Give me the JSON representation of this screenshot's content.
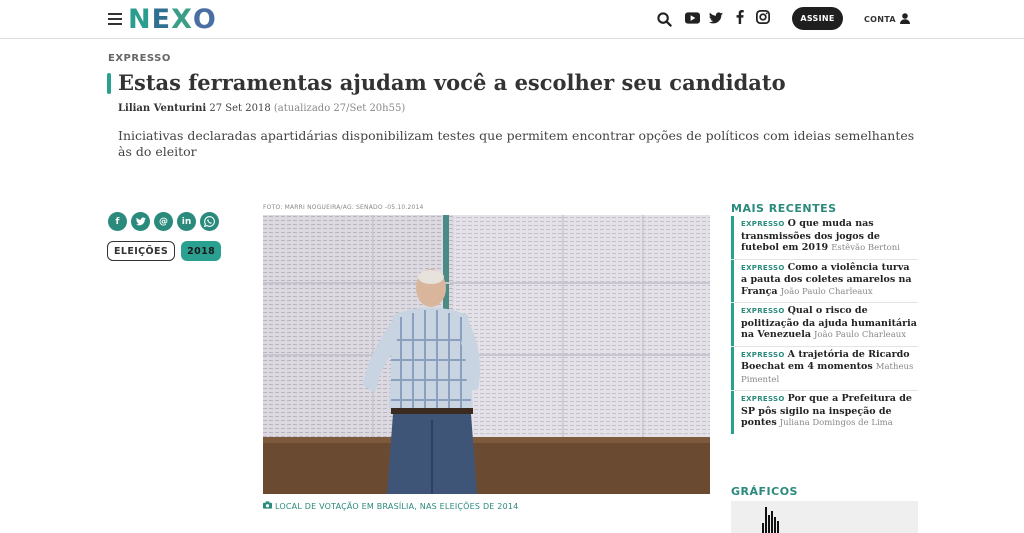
{
  "header": {
    "logo_letters": [
      {
        "char": "N",
        "color": "#2a9d8f"
      },
      {
        "char": "E",
        "color": "#2f6f8f"
      },
      {
        "char": "X",
        "color": "#3a9e88"
      },
      {
        "char": "O",
        "color": "#4a6fa5"
      }
    ],
    "icons": [
      "search-icon",
      "youtube-icon",
      "twitter-icon",
      "facebook-icon",
      "instagram-icon"
    ],
    "subscribe_label": "ASSINE",
    "account_label": "CONTA"
  },
  "article": {
    "kicker": "EXPRESSO",
    "title": "Estas ferramentas ajudam você a escolher seu candidato",
    "author": "Lilian Venturini",
    "date": "27 Set 2018",
    "updated": "(atualizado 27/Set 20h55)",
    "dek": "Iniciativas declaradas apartidárias disponibilizam testes que permitem encontrar opções de políticos com ideias semelhantes às do eleitor",
    "photo_credit": "FOTO: MARRI NOGUEIRA/AG. SENADO -05.10.2014",
    "photo_caption": "LOCAL DE VOTAÇÃO EM BRASÍLIA, NAS ELEIÇÕES DE 2014"
  },
  "share": {
    "buttons": [
      {
        "name": "facebook-share-button",
        "glyph": "f"
      },
      {
        "name": "twitter-share-button",
        "glyph": "t"
      },
      {
        "name": "email-share-button",
        "glyph": "@"
      },
      {
        "name": "linkedin-share-button",
        "glyph": "in"
      },
      {
        "name": "whatsapp-share-button",
        "glyph": "w"
      }
    ]
  },
  "tags": [
    "ELEIÇÕES",
    "2018"
  ],
  "sidebar": {
    "recent_title": "MAIS RECENTES",
    "items": [
      {
        "kicker": "EXPRESSO",
        "headline": "O que muda nas transmissões dos jogos de futebol em 2019",
        "author": "Estêvão Bertoni"
      },
      {
        "kicker": "EXPRESSO",
        "headline": "Como a violência turva a pauta dos coletes amarelos na França",
        "author": "João Paulo Charleaux"
      },
      {
        "kicker": "EXPRESSO",
        "headline": "Qual o risco de politização da ajuda humanitária na Venezuela",
        "author": "João Paulo Charleaux"
      },
      {
        "kicker": "EXPRESSO",
        "headline": "A trajetória de Ricardo Boechat em 4 momentos",
        "author": "Matheus Pimentel"
      },
      {
        "kicker": "EXPRESSO",
        "headline": "Por que a Prefeitura de SP pôs sigilo na inspeção de pontes",
        "author": "Juliana Domingos de Lima"
      }
    ],
    "graphics_title": "GRÁFICOS"
  },
  "colors": {
    "accent": "#2aa090",
    "accent_dark": "#2a8a7c",
    "text": "#333333"
  }
}
